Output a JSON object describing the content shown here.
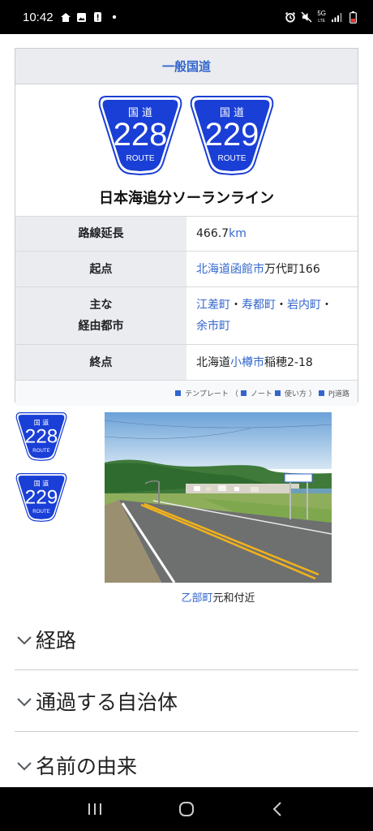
{
  "status_bar": {
    "time": "10:42",
    "network": "5G",
    "network_sub": "LTE"
  },
  "infobox": {
    "header": "一般国道",
    "shield_top_text": "国 道",
    "shield_bottom_text": "ROUTE",
    "route_numbers": [
      "228",
      "229"
    ],
    "route_name": "日本海追分ソーランライン",
    "rows": {
      "length": {
        "label": "路線延長",
        "value_num": "466.7",
        "value_unit": "km"
      },
      "start": {
        "label": "起点",
        "link1": "北海道",
        "link2": "函館市",
        "rest": "万代町166"
      },
      "via": {
        "label_line1": "主な",
        "label_line2": "経由都市",
        "city1": "江差町",
        "city2": "寿都町",
        "city3": "岩内町",
        "city4": "余市町",
        "sep": "・"
      },
      "end": {
        "label": "終点",
        "prefix": "北海道",
        "link": "小樽市",
        "rest": "稲穂2-18"
      }
    },
    "footer": {
      "template": "テンプレート",
      "paren_open": "（",
      "note": "ノート",
      "usage": "使い方",
      "paren_close": "）",
      "project": "PJ道路"
    }
  },
  "photo": {
    "caption_link": "乙部町",
    "caption_rest": "元和付近"
  },
  "sections": [
    {
      "title": "経路"
    },
    {
      "title": "通過する自治体"
    },
    {
      "title": "名前の由来"
    }
  ],
  "colors": {
    "link": "#3366cc",
    "shield_blue": "#1a3fd6",
    "header_bg": "#eaecf0"
  }
}
